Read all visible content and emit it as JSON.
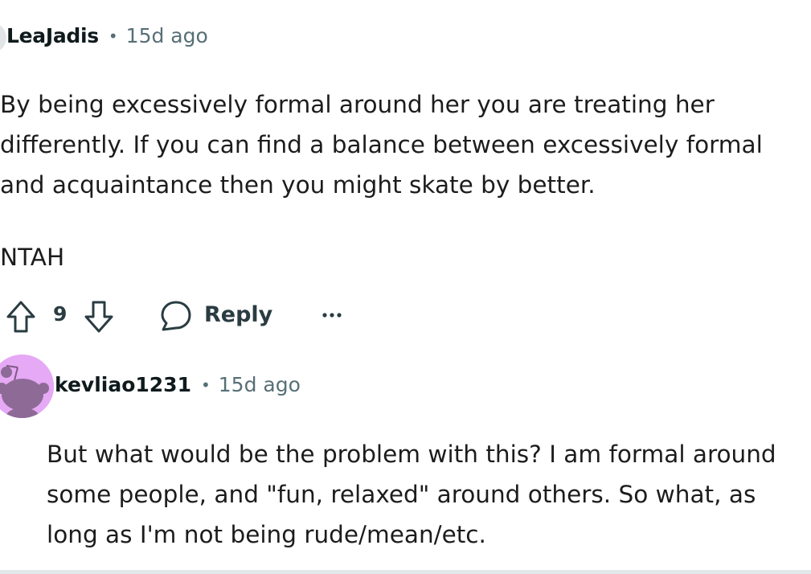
{
  "comments": [
    {
      "author": "LeaJadis",
      "separator": "•",
      "time": "15d ago",
      "body_lines": [
        "By being excessively formal around her you are treating her",
        "differently. If you can find a balance between excessively formal",
        "and acquaintance then you might skate by better."
      ],
      "body_extra": "NTAH",
      "score": "9",
      "reply_label": "Reply"
    },
    {
      "author": "kevliao1231",
      "separator": "•",
      "time": "15d ago",
      "body_lines": [
        "But what would be the problem with this? I am formal around",
        "some people, and \"fun, relaxed\" around others. So what, as",
        "long as I'm not being rude/mean/etc."
      ]
    }
  ],
  "icons": {
    "upvote": "arrow-up-outline-icon",
    "downvote": "arrow-down-outline-icon",
    "reply": "speech-bubble-icon",
    "more": "ellipsis-icon"
  },
  "colors": {
    "meta_gray": "#576f76",
    "avatar_purple": "#e6a9f5",
    "action_text": "#2a3c42"
  }
}
